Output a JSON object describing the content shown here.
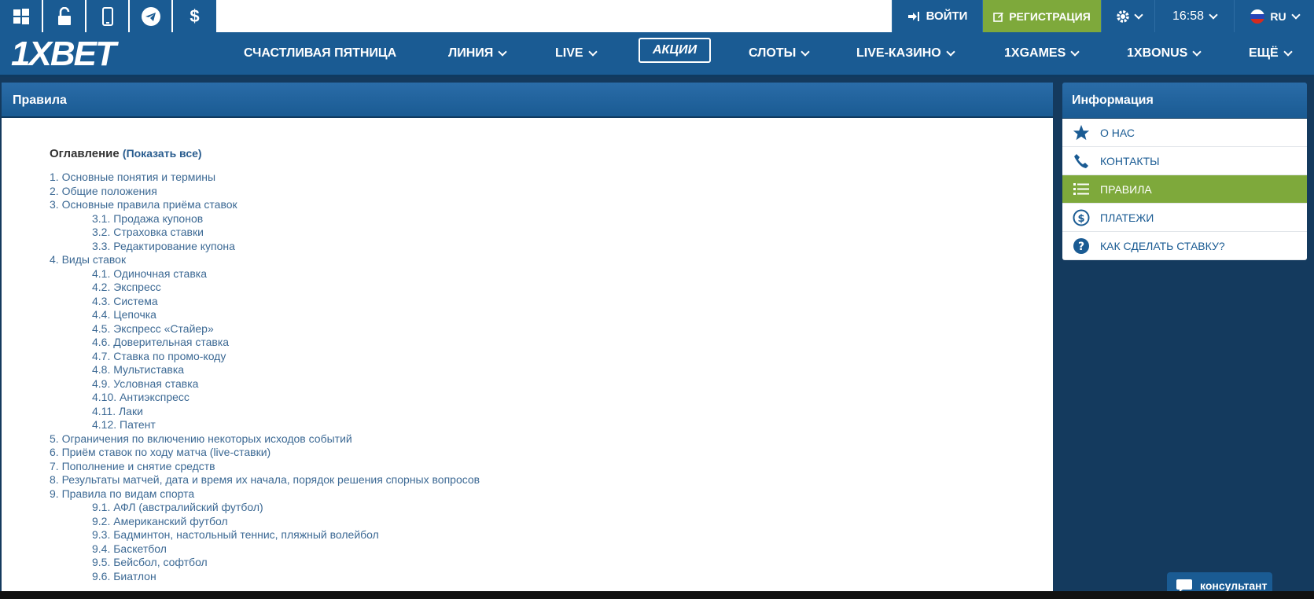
{
  "topbar": {
    "icons": [
      "windows-icon",
      "unlock-icon",
      "mobile-icon",
      "telegram-icon",
      "dollar-icon"
    ],
    "login_label": "ВОЙТИ",
    "register_label": "РЕГИСТРАЦИЯ",
    "time": "16:58",
    "lang": "RU"
  },
  "logo": {
    "part1": "1X",
    "part2": "BET"
  },
  "nav": {
    "items": [
      {
        "label": "СЧАСТЛИВАЯ ПЯТНИЦА"
      },
      {
        "label": "ЛИНИЯ"
      },
      {
        "label": "LIVE"
      },
      {
        "label": "АКЦИИ"
      },
      {
        "label": "СЛОТЫ"
      },
      {
        "label": "LIVE-КАЗИНО"
      },
      {
        "label": "1XGAMES"
      },
      {
        "label": "1XBONUS"
      },
      {
        "label": "ЕЩЁ"
      }
    ]
  },
  "main": {
    "title": "Правила",
    "toc_title": "Оглавление",
    "toc_show": "(Показать все)",
    "toc": [
      {
        "text": "1. Основные понятия и термины",
        "level": 0
      },
      {
        "text": "2. Общие положения",
        "level": 0
      },
      {
        "text": "3. Основные правила приёма ставок",
        "level": 0
      },
      {
        "text": "3.1. Продажа купонов",
        "level": 1
      },
      {
        "text": "3.2. Страховка ставки",
        "level": 1
      },
      {
        "text": "3.3. Редактирование купона",
        "level": 1
      },
      {
        "text": "4. Виды ставок",
        "level": 0
      },
      {
        "text": "4.1. Одиночная ставка",
        "level": 1
      },
      {
        "text": "4.2. Экспресс",
        "level": 1
      },
      {
        "text": "4.3. Система",
        "level": 1
      },
      {
        "text": "4.4. Цепочка",
        "level": 1
      },
      {
        "text": "4.5. Экспресс «Стайер»",
        "level": 1
      },
      {
        "text": "4.6. Доверительная ставка",
        "level": 1
      },
      {
        "text": "4.7. Ставка по промо-коду",
        "level": 1
      },
      {
        "text": "4.8. Мультиставка",
        "level": 1
      },
      {
        "text": "4.9. Условная ставка",
        "level": 1
      },
      {
        "text": "4.10. Антиэкспресс",
        "level": 1
      },
      {
        "text": "4.11. Лаки",
        "level": 1
      },
      {
        "text": "4.12. Патент",
        "level": 1
      },
      {
        "text": "5. Ограничения по включению некоторых исходов событий",
        "level": 0
      },
      {
        "text": "6. Приём ставок по ходу матча (live-ставки)",
        "level": 0
      },
      {
        "text": "7. Пополнение и снятие средств",
        "level": 0
      },
      {
        "text": "8. Результаты матчей, дата и время их начала, порядок решения спорных вопросов",
        "level": 0
      },
      {
        "text": "9. Правила по видам спорта",
        "level": 0
      },
      {
        "text": "9.1. АФЛ (австралийский футбол)",
        "level": 1
      },
      {
        "text": "9.2. Американский футбол",
        "level": 1
      },
      {
        "text": "9.3. Бадминтон, настольный теннис, пляжный волейбол",
        "level": 1
      },
      {
        "text": "9.4. Баскетбол",
        "level": 1
      },
      {
        "text": "9.5. Бейсбол, софтбол",
        "level": 1
      },
      {
        "text": "9.6. Биатлон",
        "level": 1
      }
    ]
  },
  "sidebar": {
    "title": "Информация",
    "items": [
      {
        "label": "О НАС",
        "icon": "star-icon"
      },
      {
        "label": "КОНТАКТЫ",
        "icon": "phone-icon"
      },
      {
        "label": "ПРАВИЛА",
        "icon": "list-icon",
        "active": true
      },
      {
        "label": "ПЛАТЕЖИ",
        "icon": "dollar-circle-icon"
      },
      {
        "label": "КАК СДЕЛАТЬ СТАВКУ?",
        "icon": "question-icon"
      }
    ]
  },
  "consultant_label": "консультант",
  "colors": {
    "primary": "#1a5b93",
    "accent_green": "#7ea93b",
    "background": "#143a5e"
  }
}
